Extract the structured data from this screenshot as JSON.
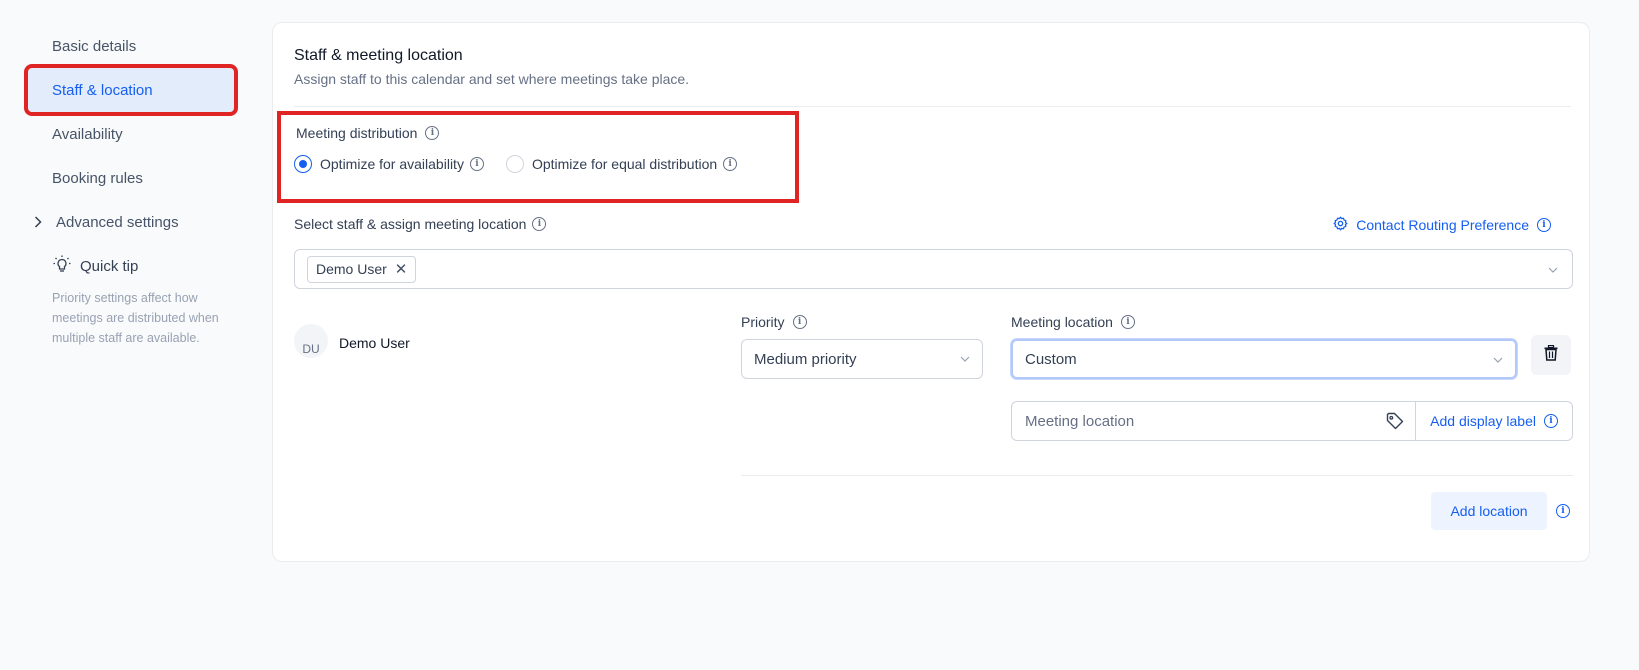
{
  "sidebar": {
    "items": [
      {
        "label": "Basic details"
      },
      {
        "label": "Staff & location"
      },
      {
        "label": "Availability"
      },
      {
        "label": "Booking rules"
      }
    ],
    "advanced_label": "Advanced settings",
    "tip": {
      "title": "Quick tip",
      "body": "Priority settings affect how meetings are distributed when multiple staff are available."
    }
  },
  "section": {
    "title": "Staff & meeting location",
    "subtitle": "Assign staff to this calendar and set where meetings take place."
  },
  "distribution": {
    "label": "Meeting distribution",
    "options": [
      {
        "label": "Optimize for availability",
        "selected": true
      },
      {
        "label": "Optimize for equal distribution",
        "selected": false
      }
    ]
  },
  "staff": {
    "label": "Select staff & assign meeting location",
    "routing_label": "Contact Routing Preference",
    "selected_chip": "Demo User"
  },
  "member": {
    "avatar_initials": "DU",
    "name": "Demo User",
    "priority_label": "Priority",
    "priority_value": "Medium priority",
    "location_label": "Meeting location",
    "location_value": "Custom",
    "location_placeholder": "Meeting location",
    "display_label_btn": "Add display label",
    "add_location_btn": "Add location"
  },
  "colors": {
    "accent": "#155eef",
    "highlight": "#e02424",
    "active_bg": "#e3ecfb"
  }
}
